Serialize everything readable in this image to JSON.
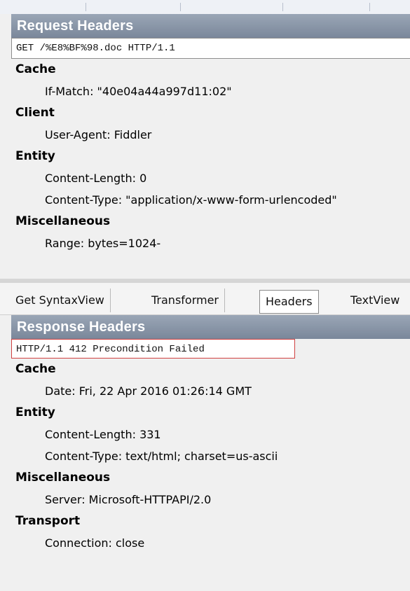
{
  "request": {
    "title": "Request Headers",
    "request_line": "GET /%E8%BF%98.doc HTTP/1.1",
    "groups": [
      {
        "label": "Cache",
        "items": [
          "If-Match: \"40e04a44a997d11:02\""
        ]
      },
      {
        "label": "Client",
        "items": [
          "User-Agent: Fiddler"
        ]
      },
      {
        "label": "Entity",
        "items": [
          "Content-Length: 0",
          "Content-Type: \"application/x-www-form-urlencoded\""
        ]
      },
      {
        "label": "Miscellaneous",
        "items": [
          "Range: bytes=1024-"
        ]
      }
    ]
  },
  "tabs": [
    {
      "label": "Get SyntaxView",
      "active": false
    },
    {
      "label": "Transformer",
      "active": false
    },
    {
      "label": "Headers",
      "active": true
    },
    {
      "label": "TextView",
      "active": false
    }
  ],
  "response": {
    "title": "Response Headers",
    "status_line": "HTTP/1.1 412 Precondition Failed",
    "groups": [
      {
        "label": "Cache",
        "items": [
          "Date: Fri, 22 Apr 2016 01:26:14 GMT"
        ]
      },
      {
        "label": "Entity",
        "items": [
          "Content-Length: 331",
          "Content-Type: text/html; charset=us-ascii"
        ]
      },
      {
        "label": "Miscellaneous",
        "items": [
          "Server: Microsoft-HTTPAPI/2.0"
        ]
      },
      {
        "label": "Transport",
        "items": [
          "Connection: close"
        ]
      }
    ]
  },
  "colors": {
    "header_bar": "#8a96a8",
    "highlight_box": "#d04040",
    "panel_bg": "#f0f0f0"
  }
}
